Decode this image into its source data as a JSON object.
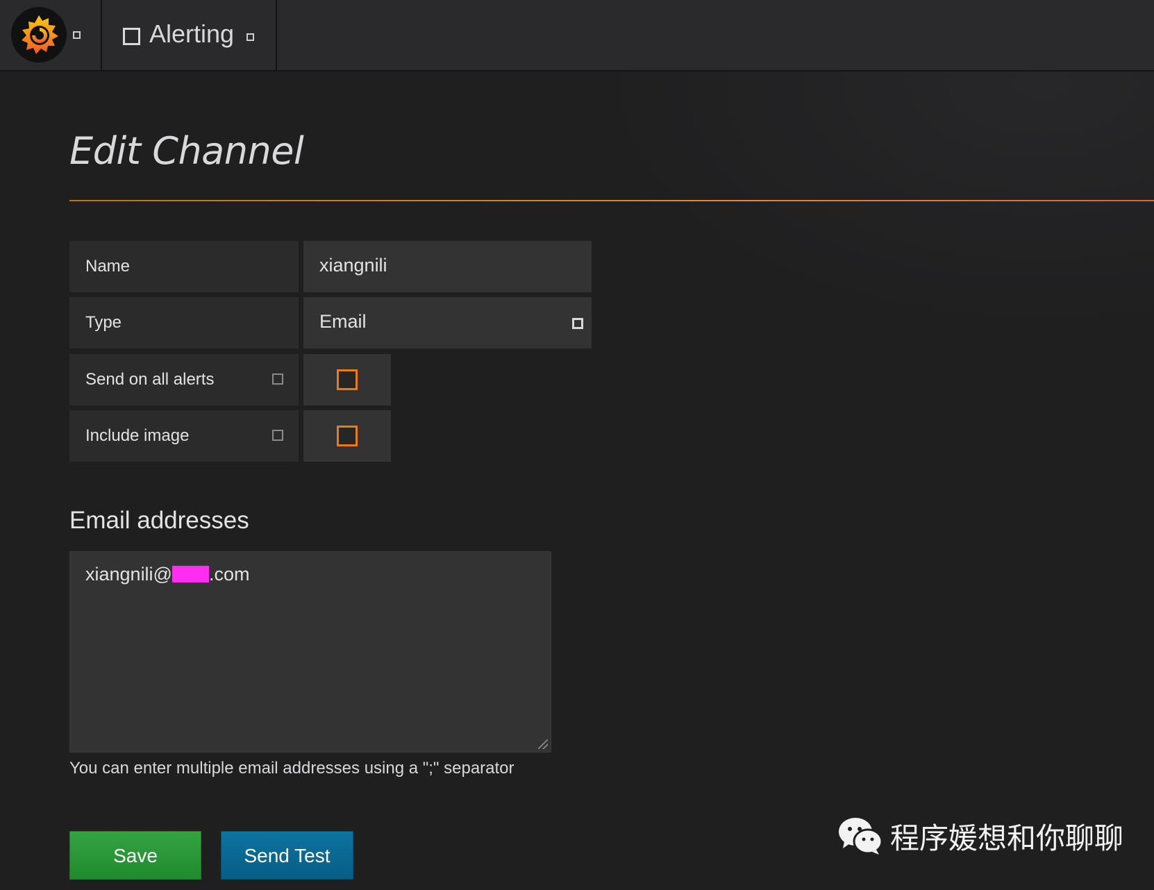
{
  "nav": {
    "logo_icon": "grafana-logo-icon",
    "section_icon": "bell-icon",
    "section_title": "Alerting"
  },
  "page": {
    "title": "Edit Channel"
  },
  "form": {
    "name_label": "Name",
    "name_value": "xiangnili",
    "type_label": "Type",
    "type_value": "Email",
    "send_all_label": "Send on all alerts",
    "send_all_checked": false,
    "include_image_label": "Include image",
    "include_image_checked": false
  },
  "email": {
    "heading": "Email addresses",
    "value_prefix": "xiangnili@",
    "value_suffix": ".com",
    "help": "You can enter multiple email addresses using a \";\" separator"
  },
  "actions": {
    "save_label": "Save",
    "test_label": "Send Test"
  },
  "watermark": {
    "icon": "wechat-icon",
    "text": "程序媛想和你聊聊"
  },
  "colors": {
    "accent": "#eb7b18",
    "save": "#299c3a",
    "test": "#0a6a96",
    "redaction": "#ff2cf1"
  }
}
